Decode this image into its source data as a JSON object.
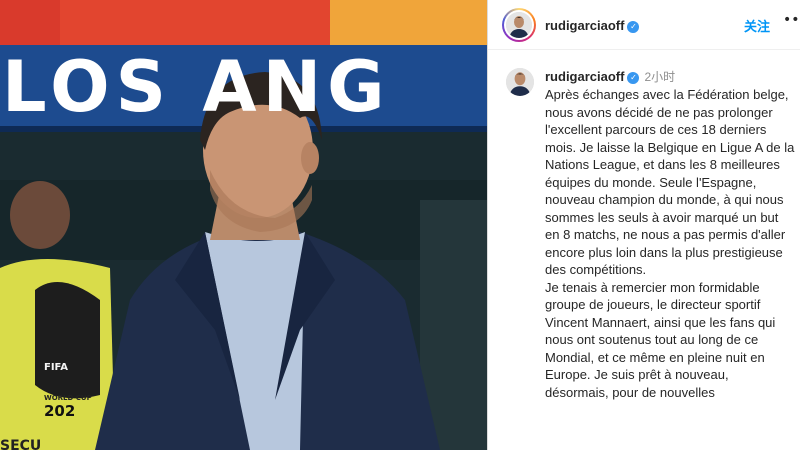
{
  "photo": {
    "banner_text": "LOS ANG",
    "badge_fifa": "FIFA",
    "badge_world_cup": "WORLD CUP",
    "badge_year": "202",
    "vest_text": "SECU"
  },
  "post": {
    "username": "rudigarciaoff",
    "follow_label": "关注",
    "more_icon": "more-icon",
    "verified_icon": "verified-badge-icon",
    "time_ago": "2小时",
    "caption_paragraph_1": "Après échanges avec la Fédération belge, nous avons décidé de ne pas prolonger l'excellent parcours de ces 18 derniers mois. Je laisse la Belgique en Ligue A de la Nations League, et dans les 8 meilleures équipes du monde. Seule l'Espagne, nouveau champion du monde, à qui nous sommes les seuls à avoir marqué un but en 8 matchs, ne nous a pas permis d'aller encore plus loin dans la plus prestigieuse des compétitions.",
    "caption_paragraph_2": "Je tenais à remercier mon formidable groupe de joueurs, le directeur sportif Vincent Mannaert, ainsi que les fans qui nous ont soutenus tout au long de ce Mondial, et ce même en pleine nuit en Europe. Je suis prêt à nouveau, désormais, pour de nouvelles"
  },
  "colors": {
    "link_blue": "#0095f6",
    "verified_blue": "#3897f0",
    "text_dark": "#262626",
    "text_muted": "#8e8e8e"
  }
}
